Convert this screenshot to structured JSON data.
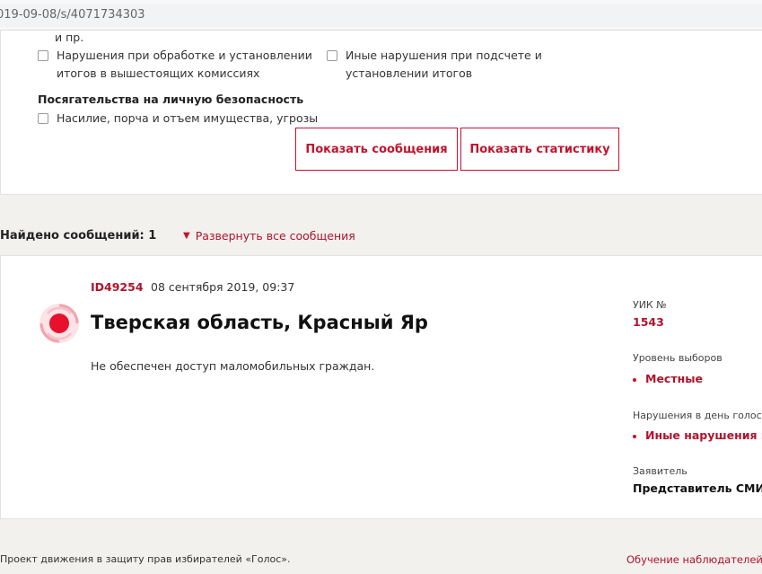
{
  "browser": {
    "url": "019-09-08/s/4071734303"
  },
  "filters": {
    "top_fragment": "и пр.",
    "items": [
      {
        "label_line1": "Нарушения при обработке и установлении",
        "label_line2": "итогов в вышестоящих комиссиях"
      },
      {
        "label_line1": "Иные нарушения при подсчете и",
        "label_line2": "установлении итогов"
      }
    ],
    "group_title": "Посягательства на личную безопасность",
    "group_items": [
      {
        "label": "Насилие, порча и отъем имущества, угрозы"
      }
    ],
    "show_messages_label": "Показать сообщения",
    "show_stats_label": "Показать статистику"
  },
  "results": {
    "found_label": "Найдено сообщений: 1",
    "expand_label": "Развернуть все сообщения"
  },
  "message": {
    "id": "ID49254",
    "date": "08 сентября 2019, 09:37",
    "title": "Тверская область, Красный Яр",
    "text": "Не обеспечен доступ маломобильных граждан.",
    "uik_label": "УИК №",
    "uik_value": "1543",
    "level_label": "Уровень выборов",
    "level_value": "Местные",
    "violations_label": "Нарушения в день голосова",
    "violations_value": "Иные нарушения в д",
    "applicant_label": "Заявитель",
    "applicant_value": "Представитель СМИ"
  },
  "footer": {
    "left_text": "Проект движения в защиту прав избирателей «Голос».",
    "right_link": "Обучение наблюдателей"
  },
  "colors": {
    "accent": "#c8102e",
    "link": "#b0132c",
    "background": "#f2f1ee"
  },
  "icons": {
    "alert": "alert-signal-icon",
    "expand": "triangle-down-icon"
  }
}
